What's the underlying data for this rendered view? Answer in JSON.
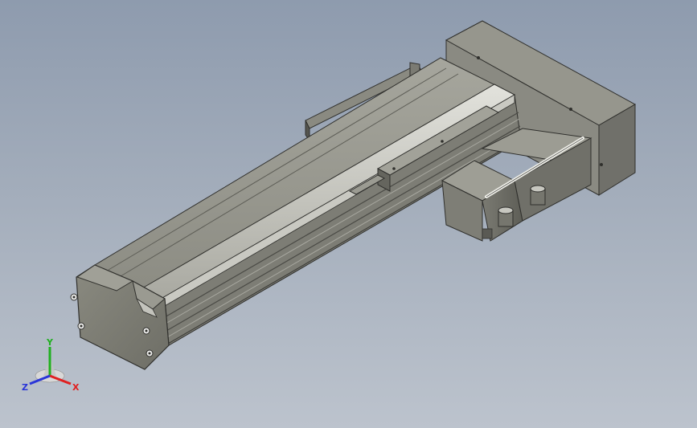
{
  "viewport": {
    "background_top": "#8e9bae",
    "background_bottom": "#bcc3cd"
  },
  "model": {
    "body_color": "#8f8f86",
    "dark_color": "#54544f",
    "light_color": "#c9c9c2",
    "outline_color": "#2f2f2c"
  },
  "triad": {
    "x_label": "X",
    "y_label": "Y",
    "z_label": "Z",
    "x_color": "#e02020",
    "y_color": "#20b020",
    "z_color": "#2a35d8"
  }
}
